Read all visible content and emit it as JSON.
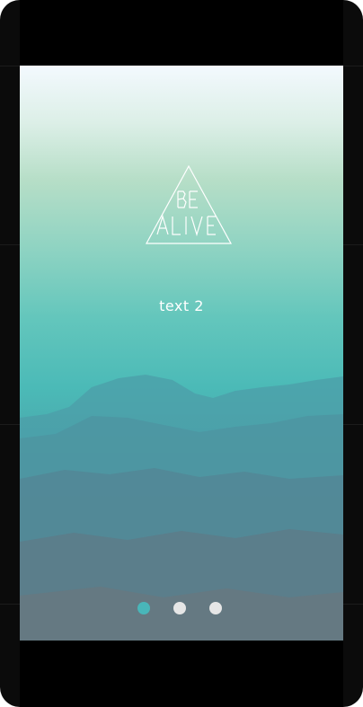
{
  "app": {
    "logo_text": "BE ALIVE",
    "subtitle": "text 2"
  },
  "pager": {
    "pages": 3,
    "active_index": 0
  },
  "colors": {
    "accent": "#49b6b9",
    "inactive_dot": "#e6e6e6"
  }
}
